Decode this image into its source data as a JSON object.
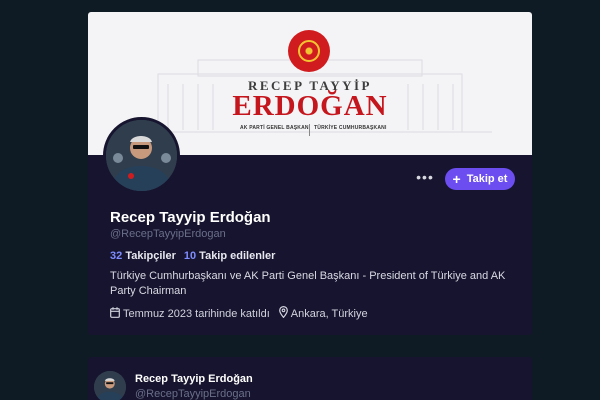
{
  "profile": {
    "banner": {
      "first_name": "RECEP TAYYİP",
      "last_name": "ERDOĞAN",
      "sub_left": "AK PARTİ GENEL BAŞKANI",
      "sub_right": "TÜRKİYE CUMHURBAŞKANI"
    },
    "more_icon": "more-dots-icon",
    "follow_button_label": "Takip et",
    "display_name": "Recep Tayyip Erdoğan",
    "handle": "@RecepTayyipErdogan",
    "followers_count": "32",
    "followers_label": "Takipçiler",
    "following_count": "10",
    "following_label": "Takip edilenler",
    "bio": "Türkiye Cumhurbaşkanı ve AK Parti Genel Başkanı - President of Türkiye and AK Party Chairman",
    "joined": "Temmuz 2023 tarihinde katıldı",
    "location": "Ankara, Türkiye"
  },
  "post": {
    "author_name": "Recep Tayyip Erdoğan",
    "author_handle": "@RecepTayyipErdogan"
  },
  "colors": {
    "page_background": "#0f1b24",
    "card_background": "#16142e",
    "accent": "#6b4df0",
    "link_number": "#7f8cff",
    "banner_red": "#c5161d"
  }
}
